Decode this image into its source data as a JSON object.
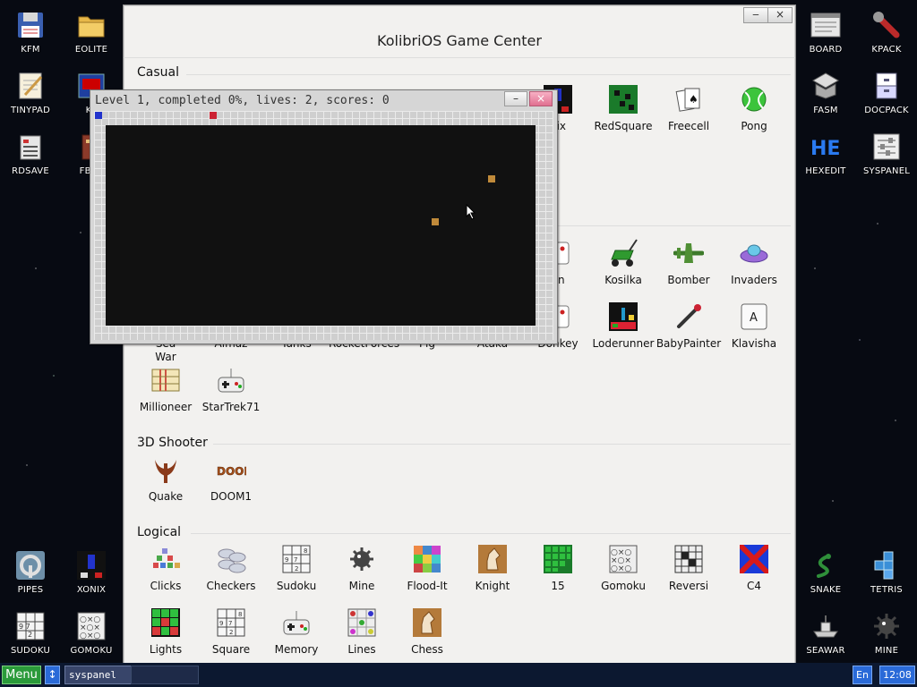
{
  "desktop": {
    "left_icons": [
      {
        "label": "KFM",
        "icon": "floppy-disk-icon"
      },
      {
        "label": "EOLITE",
        "icon": "folder-icon"
      },
      {
        "label": "TINYPAD",
        "icon": "notepad-icon"
      },
      {
        "label": "KF",
        "icon": "kfar-icon"
      },
      {
        "label": "RDSAVE",
        "icon": "rdsave-icon"
      },
      {
        "label": "FB2R",
        "icon": "book-icon"
      },
      {
        "label": "PIPES",
        "icon": "pipes-icon"
      },
      {
        "label": "XONIX",
        "icon": "xonix-icon"
      },
      {
        "label": "SUDOKU",
        "icon": "sudoku-icon"
      },
      {
        "label": "GOMOKU",
        "icon": "gomoku-icon"
      }
    ],
    "right_icons": [
      {
        "label": "BOARD",
        "icon": "board-icon"
      },
      {
        "label": "KPACK",
        "icon": "wrench-icon"
      },
      {
        "label": "FASM",
        "icon": "fasm-icon"
      },
      {
        "label": "DOCPACK",
        "icon": "docpack-icon"
      },
      {
        "label": "HEXEDIT",
        "icon": "hexedit-icon"
      },
      {
        "label": "SYSPANEL",
        "icon": "syspanel-icon"
      },
      {
        "label": "SNAKE",
        "icon": "snake-icon"
      },
      {
        "label": "TETRIS",
        "icon": "tetris-icon"
      },
      {
        "label": "SEAWAR",
        "icon": "seawar-icon"
      },
      {
        "label": "MINE",
        "icon": "mine-icon"
      }
    ]
  },
  "game_center": {
    "title": "KolibriOS Game Center",
    "minimize": "‒",
    "close": "×",
    "sections": {
      "casual": {
        "title": "Casual",
        "row1": [
          "nix",
          "RedSquare",
          "Freecell",
          "Pong"
        ],
        "row2": [
          "un",
          "Kosilka",
          "Bomber",
          "Invaders"
        ],
        "row3": [
          "Sea War",
          "Almaz",
          "Tanks",
          "RocketForces",
          "Pig",
          "Ataka",
          "Donkey",
          "Loderunner",
          "BabyPainter",
          "Klavisha"
        ],
        "row4": [
          "Millioneer",
          "StarTrek71"
        ]
      },
      "shooter": {
        "title": "3D Shooter",
        "items": [
          "Quake",
          "DOOM1"
        ]
      },
      "logical": {
        "title": "Logical",
        "row1": [
          "Clicks",
          "Checkers",
          "Sudoku",
          "Mine",
          "Flood-It",
          "Knight",
          "15",
          "Gomoku",
          "Reversi",
          "C4"
        ],
        "row2": [
          "Lights",
          "Square",
          "Memory",
          "Lines",
          "Chess"
        ]
      }
    }
  },
  "xonix_window": {
    "title": "Level 1, completed 0%, lives: 2, scores: 0",
    "minimize": "–",
    "close": "×",
    "player_color": "#2233cc",
    "enemy_border_color": "#cc2233",
    "ball_color": "#c08a3a"
  },
  "taskbar": {
    "menu": "Menu",
    "switch": "↕",
    "task": "syspanel",
    "lang": "En",
    "clock": "12:08"
  }
}
